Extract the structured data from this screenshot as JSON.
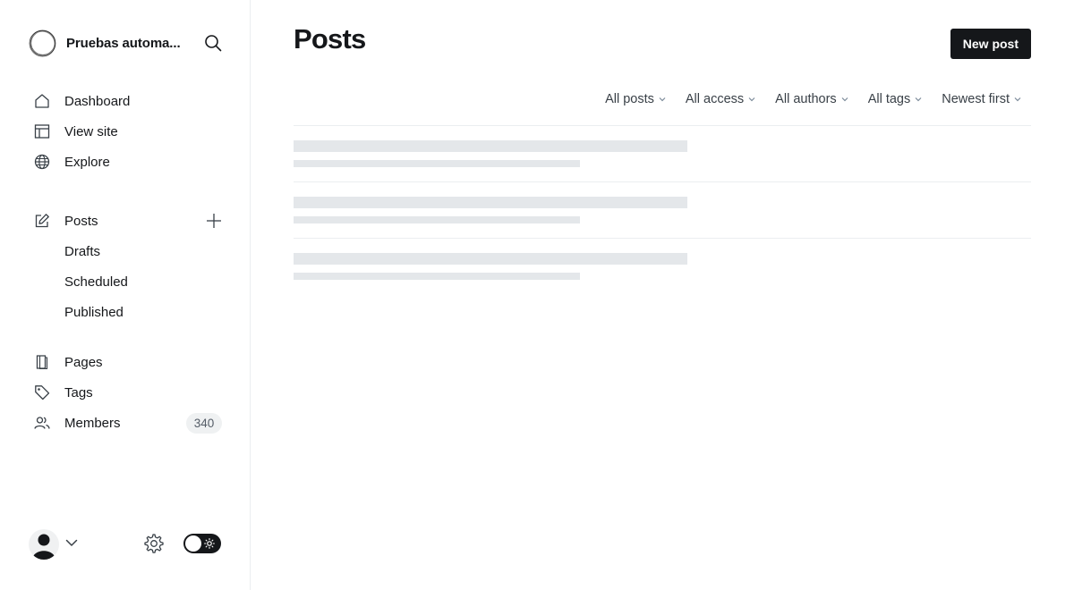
{
  "sidebar": {
    "site_title": "Pruebas automa...",
    "nav_primary": [
      {
        "label": "Dashboard",
        "icon": "home-icon"
      },
      {
        "label": "View site",
        "icon": "layout-icon"
      },
      {
        "label": "Explore",
        "icon": "globe-icon"
      }
    ],
    "posts": {
      "label": "Posts",
      "icon": "edit-icon",
      "sub": [
        "Drafts",
        "Scheduled",
        "Published"
      ]
    },
    "nav_secondary": [
      {
        "label": "Pages",
        "icon": "page-icon"
      },
      {
        "label": "Tags",
        "icon": "tag-icon"
      },
      {
        "label": "Members",
        "icon": "members-icon",
        "count": "340"
      }
    ]
  },
  "main": {
    "title": "Posts",
    "new_post_label": "New post",
    "filters": [
      "All posts",
      "All access",
      "All authors",
      "All tags",
      "Newest first"
    ],
    "loading_rows": 3
  },
  "colors": {
    "primary_dark": "#15171a",
    "skeleton": "#e4e7ea",
    "divider": "#ebeef0",
    "badge_bg": "#eff1f2"
  }
}
